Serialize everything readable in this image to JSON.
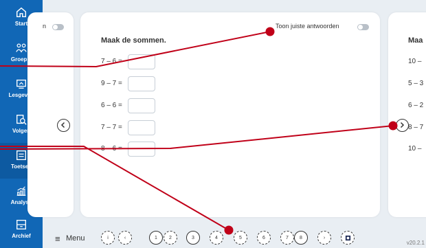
{
  "sidebar": {
    "items": [
      {
        "label": "Start",
        "icon": "home-icon"
      },
      {
        "label": "Groep 4",
        "icon": "group-icon"
      },
      {
        "label": "Lesgeven",
        "icon": "teach-icon"
      },
      {
        "label": "Volgen",
        "icon": "track-icon"
      },
      {
        "label": "Toetsen",
        "icon": "test-icon"
      },
      {
        "label": "Analyse",
        "icon": "analysis-icon"
      },
      {
        "label": "Archief",
        "icon": "archive-icon"
      }
    ],
    "active": "Toetsen"
  },
  "left_card": {
    "toggle_label_fragment": "n"
  },
  "main_card": {
    "toggle_label": "Toon juiste antwoorden",
    "title": "Maak de sommen.",
    "sums": [
      "7 – 6 =",
      "9 – 7 =",
      "6 – 6 =",
      "7 – 7 =",
      "8 – 6 ="
    ]
  },
  "right_card": {
    "title_fragment": "Maa",
    "sums_fragments": [
      "10 –",
      "5 – 3",
      "6 – 2",
      "8 – 7",
      "10 –"
    ]
  },
  "bottom": {
    "menu_label": "Menu",
    "pages": [
      "i",
      "‹",
      "1",
      "2",
      "3",
      "4",
      "5",
      "6",
      "7",
      "8",
      "›",
      "flag"
    ],
    "version": "v20.2.1"
  },
  "colors": {
    "sidebar": "#1167b6",
    "annotation": "#c00018"
  }
}
